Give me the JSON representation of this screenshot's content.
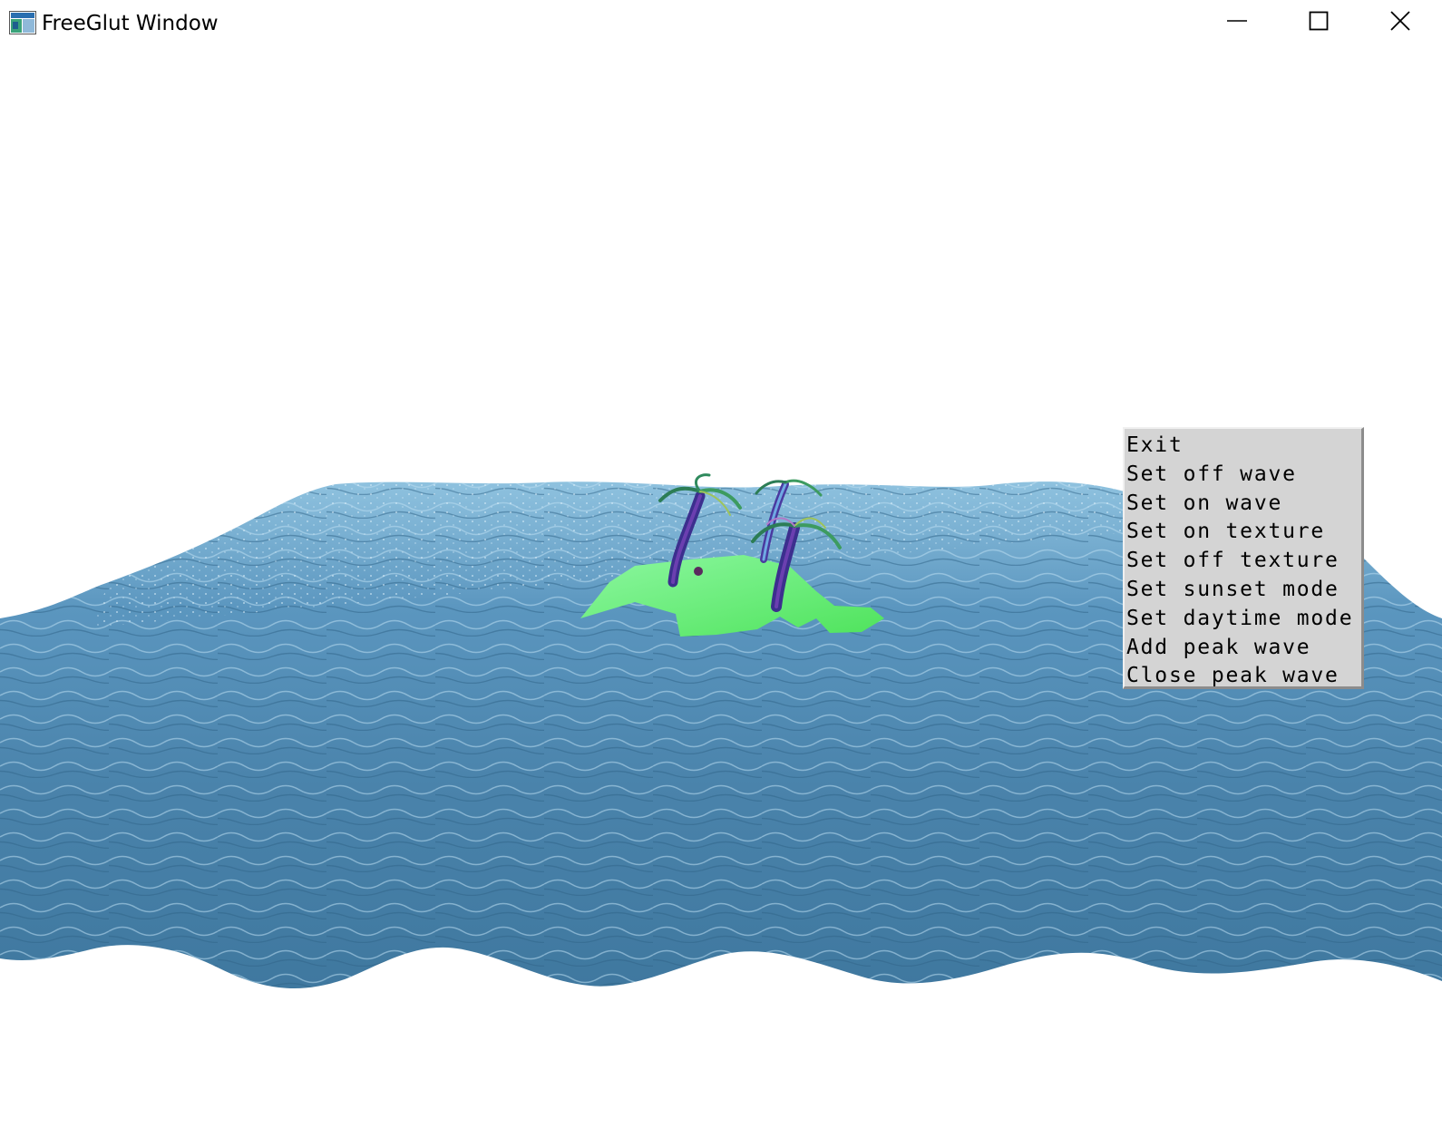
{
  "window": {
    "title": "FreeGlut Window",
    "app_icon": "freeglut-app-icon",
    "controls": {
      "minimize_icon": "minimize-icon",
      "maximize_icon": "maximize-icon",
      "close_icon": "close-icon"
    }
  },
  "scene": {
    "ocean_color": "#4f86ab",
    "ocean_highlight": "#a8d2ea",
    "island_color": "#6ef07a",
    "palm_trunk_color": "#3c2f8e"
  },
  "context_menu": {
    "items": [
      {
        "label": "Exit"
      },
      {
        "label": "Set off wave"
      },
      {
        "label": "Set on wave"
      },
      {
        "label": "Set on texture"
      },
      {
        "label": "Set off texture"
      },
      {
        "label": "Set sunset mode"
      },
      {
        "label": "Set daytime mode"
      },
      {
        "label": "Add peak wave"
      },
      {
        "label": "Close peak wave"
      }
    ]
  }
}
